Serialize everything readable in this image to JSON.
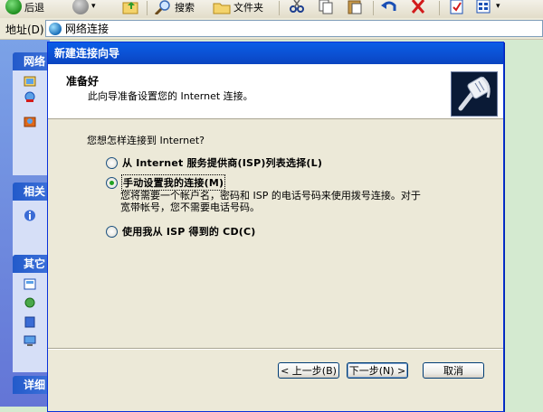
{
  "toolbar": {
    "back_label": "后退",
    "search_label": "搜索",
    "folders_label": "文件夹"
  },
  "address": {
    "label": "地址(D)",
    "value": "网络连接"
  },
  "taskpane": {
    "group1": "网络",
    "group2": "相关",
    "group3": "其它",
    "group4": "详细"
  },
  "dialog": {
    "title": "新建连接向导",
    "header_title": "准备好",
    "header_subtitle": "此向导准备设置您的 Internet 连接。",
    "question": "您想怎样连接到 Internet?",
    "options": [
      {
        "label": "从 Internet 服务提供商(ISP)列表选择",
        "key": "(L)",
        "selected": false
      },
      {
        "label": "手动设置我的连接",
        "key": "(M)",
        "selected": true
      },
      {
        "label": "使用我从 ISP 得到的 CD",
        "key": "(C)",
        "selected": false
      }
    ],
    "manual_description_line1": "您将需要一个帐户名，密码和 ISP 的电话号码来使用拨号连接。对于",
    "manual_description_line2": "宽带帐号，您不需要电话号码。",
    "back_button": "< 上一步(B)",
    "next_button": "下一步(N) >",
    "cancel_button": "取消"
  },
  "colors": {
    "titlebar": "#0a5ee7",
    "dialog_bg": "#ece9d8",
    "desktop_bg": "#d4ead0",
    "taskpane": "#6375d6"
  }
}
